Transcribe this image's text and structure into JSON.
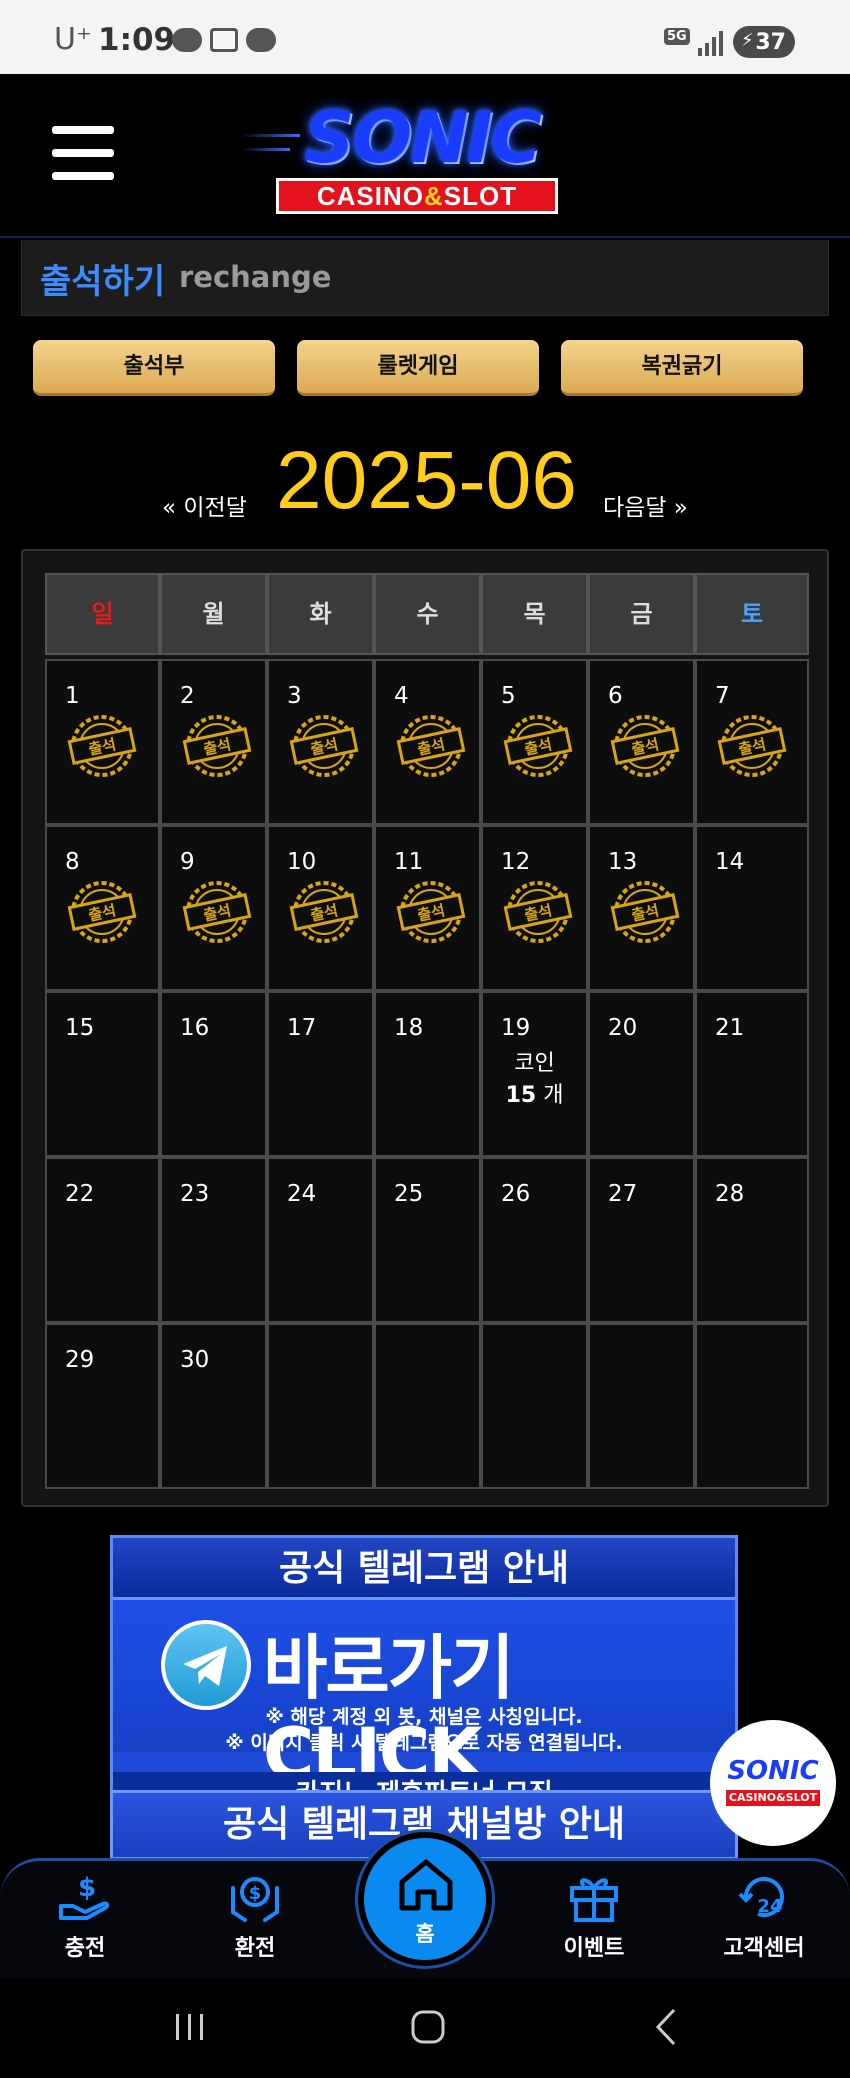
{
  "status_bar": {
    "carrier": "U⁺",
    "time": "1:09",
    "network": "5G",
    "battery": "37"
  },
  "header": {
    "logo_main": "SONIC",
    "logo_sub_left": "CASINO",
    "logo_sub_amp": "&",
    "logo_sub_right": "SLOT"
  },
  "title": {
    "korean": "출석하기",
    "english": "rechange"
  },
  "tabs": [
    "출석부",
    "룰렛게임",
    "복권긁기"
  ],
  "month_nav": {
    "prev": "« 이전달",
    "current": "2025-06",
    "next": "다음달 »"
  },
  "calendar": {
    "weekdays": [
      "일",
      "월",
      "화",
      "수",
      "목",
      "금",
      "토"
    ],
    "weekday_colors": [
      "#e61b1b",
      "#dddddd",
      "#dddddd",
      "#dddddd",
      "#dddddd",
      "#dddddd",
      "#4aa3ff"
    ],
    "weeks": [
      [
        "1",
        "2",
        "3",
        "4",
        "5",
        "6",
        "7"
      ],
      [
        "8",
        "9",
        "10",
        "11",
        "12",
        "13",
        "14"
      ],
      [
        "15",
        "16",
        "17",
        "18",
        "19",
        "20",
        "21"
      ],
      [
        "22",
        "23",
        "24",
        "25",
        "26",
        "27",
        "28"
      ],
      [
        "29",
        "30",
        "",
        "",
        "",
        "",
        ""
      ]
    ],
    "attended_days": [
      "1",
      "2",
      "3",
      "4",
      "5",
      "6",
      "7",
      "8",
      "9",
      "10",
      "11",
      "12",
      "13"
    ],
    "stamp_text": "출석",
    "coin_day": "19",
    "coin_label": "코인",
    "coin_count": "15",
    "coin_unit": "개"
  },
  "banner": {
    "top_text": "공식 텔레그램 안내",
    "click_text": "바로가기 CLICK",
    "note1": "※ 해당 계정 외 봇, 채널은 사칭입니다.",
    "note2": "※ 이미지 클릭 시 텔레그램으로 자동 연결됩니다.",
    "strip": "카지노 제휴파트너 모집",
    "second_text": "공식 텔레그램 채널방 안내"
  },
  "float_logo": {
    "main": "SONIC",
    "sub": "CASINO&SLOT"
  },
  "bottom_nav": {
    "charge": "충전",
    "exchange": "환전",
    "home": "홈",
    "event": "이벤트",
    "support": "고객센터"
  }
}
